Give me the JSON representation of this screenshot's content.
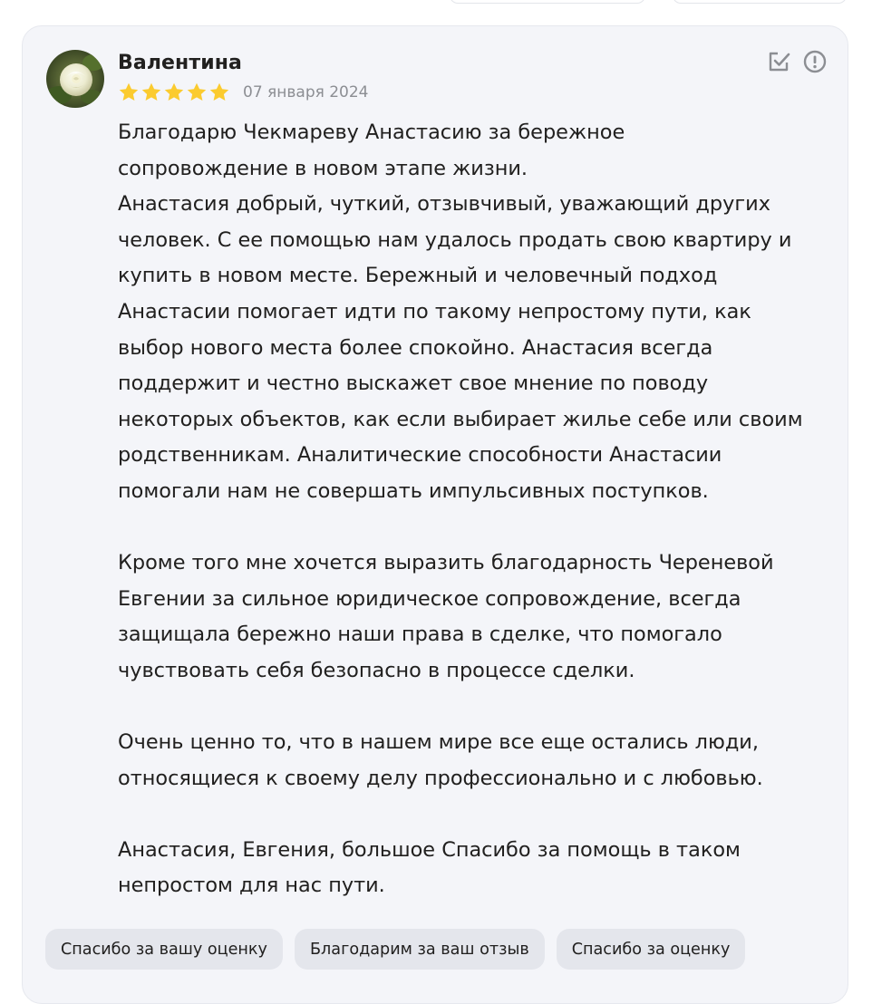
{
  "review": {
    "author": "Валентина",
    "rating": 5,
    "rating_max": 5,
    "date": "07 января 2024",
    "paragraphs": [
      "Благодарю Чекмареву Анастасию за бережное\nсопровождение в новом этапе жизни.\nАнастасия добрый, чуткий, отзывчивый, уважающий других\nчеловек. С ее помощью нам удалось продать свою квартиру и\nкупить в новом месте. Бережный и человечный подход\nАнастасии помогает идти по такому непростому пути, как\nвыбор нового места более спокойно. Анастасия всегда\nподдержит и честно выскажет свое мнение по поводу\nнекоторых объектов, как если выбирает жилье себе или своим\nродственникам. Аналитические способности Анастасии\nпомогали нам не совершать импульсивных поступков.",
      "Кроме того мне хочется выразить благодарность Череневой\nЕвгении за сильное юридическое сопровождение, всегда\nзащищала бережно наши права в сделке, что помогало\nчувствовать себя безопасно в процессе сделки.",
      "Очень ценно то, что в нашем мире все еще остались люди,\nотносящиеся к своему делу профессионально и с любовью.",
      "Анастасия, Евгения, большое Спасибо за помощь в таком\nнепростом для нас пути."
    ],
    "actions": [
      {
        "icon": "edit-check-icon"
      },
      {
        "icon": "report-icon"
      }
    ],
    "quick_replies": [
      "Спасибо за вашу оценку",
      "Благодарим за ваш отзыв",
      "Спасибо за оценку"
    ]
  },
  "colors": {
    "card_bg": "#f4f5f9",
    "star": "#fbcb2f",
    "text": "#21201f",
    "muted": "#8c8e93",
    "chip_bg": "#e4e6ec",
    "icon": "#8c8e93"
  }
}
